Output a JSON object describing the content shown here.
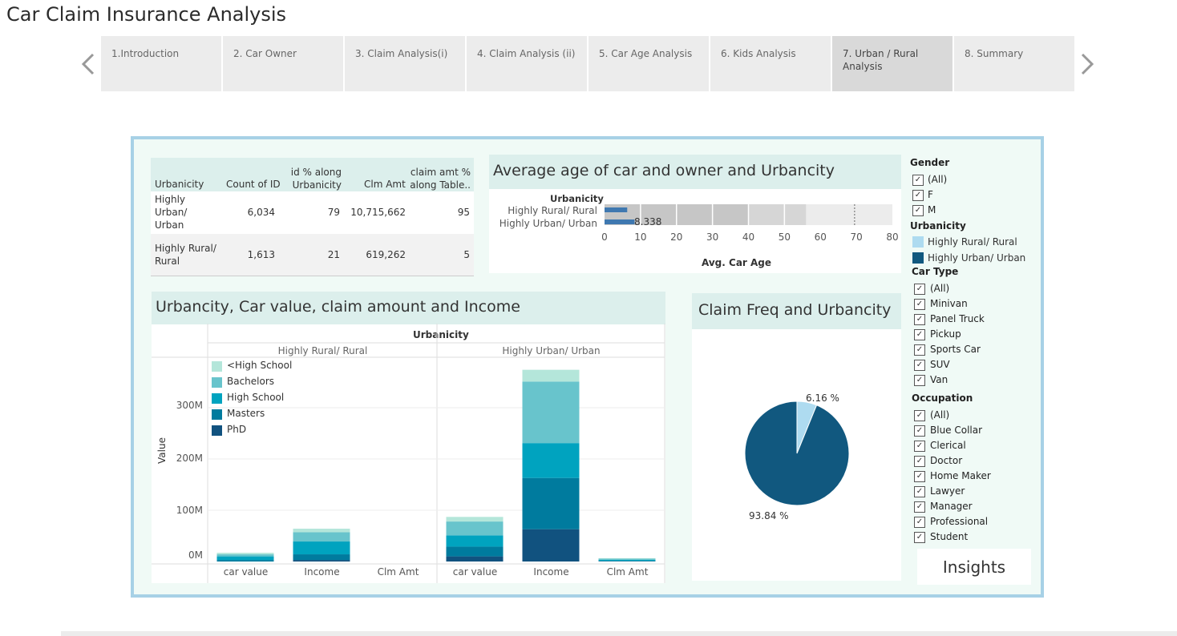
{
  "title": "Car Claim Insurance Analysis",
  "tabs": [
    "1.Introduction",
    "2. Car Owner",
    "3. Claim Analysis(i)",
    "4. Claim Analysis (ii)",
    "5. Car  Age Analysis",
    "6. Kids Analysis",
    "7. Urban / Rural Analysis",
    "8. Summary"
  ],
  "active_tab": 6,
  "table": {
    "headers": {
      "urbanicity": "Urbanicity",
      "count": "Count of ID",
      "idpct": "id % along Urbanicity",
      "clm": "Clm Amt",
      "clmpct": "claim amt % along Table.."
    },
    "rows": [
      {
        "urbanicity": "Highly Urban/ Urban",
        "count": "6,034",
        "idpct": "79",
        "clm": "10,715,662",
        "clmpct": "95"
      },
      {
        "urbanicity": "Highly Rural/ Rural",
        "count": "1,613",
        "idpct": "21",
        "clm": "619,262",
        "clmpct": "5"
      }
    ]
  },
  "age_chart": {
    "title": "Average age of car and owner and Urbancity",
    "dim_label": "Urbanicity",
    "rows": [
      "Highly Rural/ Rural",
      "Highly Urban/ Urban"
    ],
    "label_value": "8.338",
    "ticks": [
      "0",
      "10",
      "20",
      "30",
      "40",
      "50",
      "60",
      "70",
      "80"
    ],
    "xlabel": "Avg. Car Age"
  },
  "stack_chart": {
    "title": "Urbancity, Car value, claim amount and Income",
    "header": "Urbanicity",
    "groups": [
      "Highly Rural/ Rural",
      "Highly Urban/ Urban"
    ],
    "measures": [
      "car value",
      "Income",
      "Clm Amt",
      "car value",
      "Income",
      "Clm Amt"
    ],
    "yticks": [
      "300M",
      "200M",
      "100M",
      "0M"
    ],
    "ylabel": "Value",
    "legend": [
      {
        "label": "<High School",
        "color": "#b4e6da"
      },
      {
        "label": "Bachelors",
        "color": "#68c4cc"
      },
      {
        "label": "High School",
        "color": "#00a3bf"
      },
      {
        "label": "Masters",
        "color": "#007b9e"
      },
      {
        "label": "PhD",
        "color": "#11527f"
      }
    ]
  },
  "pie_chart": {
    "title": "Claim Freq and Urbancity",
    "labels": [
      "6.16 %",
      "93.84 %"
    ],
    "colors": {
      "rural": "#aedbf0",
      "urban": "#11587f"
    }
  },
  "chart_data": [
    {
      "type": "bar",
      "title": "Average age of car and owner and Urbancity",
      "categories": [
        "Highly Rural/ Rural",
        "Highly Urban/ Urban"
      ],
      "series": [
        {
          "values": [
            6.3,
            8.338
          ]
        }
      ],
      "xlabel": "Avg. Car Age",
      "ylabel": "Urbanicity",
      "xlim": [
        0,
        80
      ]
    },
    {
      "type": "bar",
      "title": "Urbancity, Car value, claim amount and Income",
      "categories": [
        "Highly Rural/ Rural - car value",
        "Highly Rural/ Rural - Income",
        "Highly Rural/ Rural - Clm Amt",
        "Highly Urban/ Urban - car value",
        "Highly Urban/ Urban - Income",
        "Highly Urban/ Urban - Clm Amt"
      ],
      "series": [
        {
          "name": "<High School",
          "values": [
            3,
            7,
            0,
            9,
            23,
            1
          ]
        },
        {
          "name": "Bachelors",
          "values": [
            4,
            18,
            0,
            27,
            120,
            2
          ]
        },
        {
          "name": "High School",
          "values": [
            7,
            25,
            0,
            22,
            68,
            2
          ]
        },
        {
          "name": "Masters",
          "values": [
            3,
            11,
            0,
            19,
            100,
            1
          ]
        },
        {
          "name": "PhD",
          "values": [
            0,
            3,
            0,
            10,
            63,
            0.5
          ]
        }
      ],
      "ylabel": "Value",
      "ylim": [
        0,
        380
      ]
    },
    {
      "type": "pie",
      "title": "Claim Freq and Urbancity",
      "categories": [
        "Highly Rural/ Rural",
        "Highly Urban/ Urban"
      ],
      "values": [
        6.16,
        93.84
      ]
    }
  ],
  "filters": {
    "gender_title": "Gender",
    "gender": [
      "(All)",
      "F",
      "M"
    ],
    "urbanicity_title": "Urbanicity",
    "urbanicity": [
      "Highly Rural/ Rural",
      "Highly Urban/ Urban"
    ],
    "cartype_title": "Car Type",
    "cartype": [
      "(All)",
      "Minivan",
      "Panel Truck",
      "Pickup",
      "Sports Car",
      "SUV",
      "Van"
    ],
    "occupation_title": "Occupation",
    "occupation": [
      "(All)",
      "Blue Collar",
      "Clerical",
      "Doctor",
      "Home Maker",
      "Lawyer",
      "Manager",
      "Professional",
      "Student"
    ]
  },
  "insights_label": "Insights"
}
